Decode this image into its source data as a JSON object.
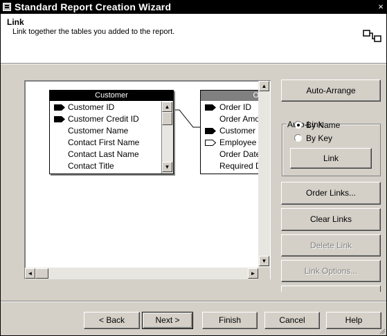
{
  "window": {
    "title": "Standard Report Creation Wizard",
    "close_glyph": "×",
    "icon": "window-system-icon"
  },
  "header": {
    "title": "Link",
    "subtitle": "Link together the tables you added to the report.",
    "icon": "link-tables-icon"
  },
  "customer_table": {
    "title": "Customer",
    "fields": [
      {
        "name": "Customer ID",
        "key": "primary"
      },
      {
        "name": "Customer Credit ID",
        "key": "primary"
      },
      {
        "name": "Customer Name",
        "key": "none"
      },
      {
        "name": "Contact First Name",
        "key": "none"
      },
      {
        "name": "Contact Last Name",
        "key": "none"
      },
      {
        "name": "Contact Title",
        "key": "none"
      }
    ]
  },
  "orders_table": {
    "title": "O",
    "fields": [
      {
        "name": "Order ID",
        "key": "primary"
      },
      {
        "name": "Order Amount",
        "key": "none"
      },
      {
        "name": "Customer ID",
        "key": "primary"
      },
      {
        "name": "Employee ID",
        "key": "foreign"
      },
      {
        "name": "Order Date",
        "key": "none"
      },
      {
        "name": "Required Date",
        "key": "none"
      }
    ]
  },
  "side_buttons": {
    "auto_arrange": "Auto-Arrange",
    "auto_link_label": "Auto-Link",
    "by_name": "By Name",
    "by_key": "By Key",
    "link": "Link",
    "order_links": "Order Links...",
    "clear_links": "Clear Links",
    "delete_link": "Delete Link",
    "link_options": "Link Options..."
  },
  "auto_link_selected": "By Name",
  "footer": {
    "back": "< Back",
    "next": "Next >",
    "finish": "Finish",
    "cancel": "Cancel",
    "help": "Help"
  }
}
